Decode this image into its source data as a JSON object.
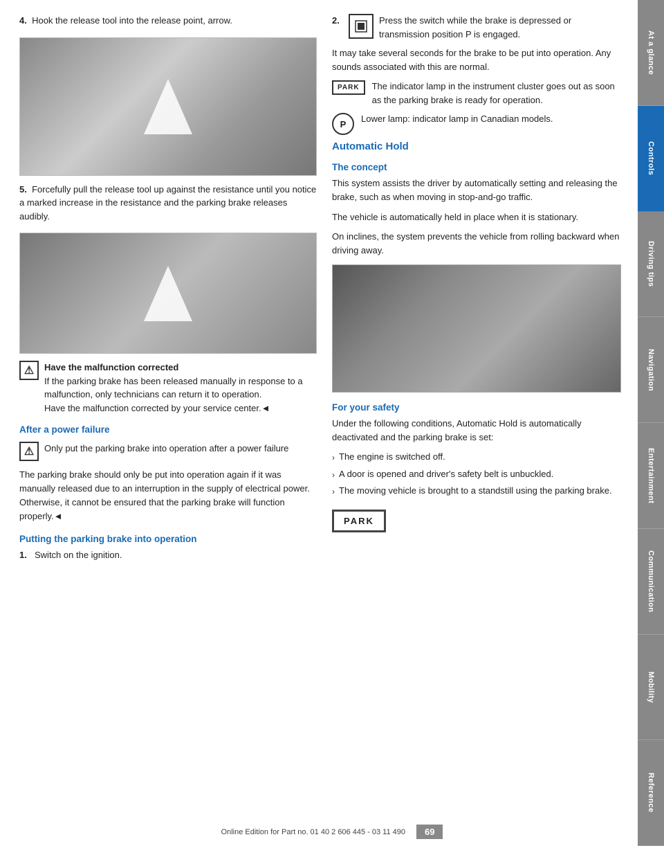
{
  "sidebar": {
    "tabs": [
      {
        "label": "At a glance",
        "active": false
      },
      {
        "label": "Controls",
        "active": true
      },
      {
        "label": "Driving tips",
        "active": false
      },
      {
        "label": "Navigation",
        "active": false
      },
      {
        "label": "Entertainment",
        "active": false
      },
      {
        "label": "Communication",
        "active": false
      },
      {
        "label": "Mobility",
        "active": false
      },
      {
        "label": "Reference",
        "active": false
      }
    ]
  },
  "left_col": {
    "step4": {
      "number": "4.",
      "text": "Hook the release tool into the release point, arrow."
    },
    "step5": {
      "number": "5.",
      "text": "Forcefully pull the release tool up against the resistance until you notice a marked increase in the resistance and the parking brake releases audibly."
    },
    "warning1": {
      "text": "Have the malfunction corrected\nIf the parking brake has been released manually in response to a malfunction, only technicians can return it to operation.\nHave the malfunction corrected by your service center.◄"
    },
    "section_power": "After a power failure",
    "warning2": {
      "text": "Only put the parking brake into operation after a power failure"
    },
    "power_text1": "The parking brake should only be put into operation again if it was manually released due to an interruption in the supply of electrical power. Otherwise, it cannot be ensured that the parking brake will function properly.◄",
    "section_putting": "Putting the parking brake into operation",
    "step1_put": {
      "number": "1.",
      "text": "Switch on the ignition."
    }
  },
  "right_col": {
    "step2": {
      "number": "2.",
      "text": "Press the switch while the brake is depressed or transmission position P is engaged."
    },
    "text_seconds": "It may take several seconds for the brake to be put into operation. Any sounds associated with this are normal.",
    "indicator1_label": "PARK",
    "indicator1_text": "The indicator lamp in the instrument cluster goes out as soon as the parking brake is ready for operation.",
    "indicator2_text": "Lower lamp: indicator lamp in Canadian models.",
    "section_auto": "Automatic Hold",
    "section_concept": "The concept",
    "concept_text1": "This system assists the driver by automatically setting and releasing the brake, such as when moving in stop-and-go traffic.",
    "concept_text2": "The vehicle is automatically held in place when it is stationary.",
    "concept_text3": "On inclines, the system prevents the vehicle from rolling backward when driving away.",
    "section_safety": "For your safety",
    "safety_intro": "Under the following conditions, Automatic Hold is automatically deactivated and the parking brake is set:",
    "safety_bullets": [
      "The engine is switched off.",
      "A door is opened and driver's safety belt is unbuckled.",
      "The moving vehicle is brought to a standstill using the parking brake."
    ],
    "park_badge_bottom": "PARK"
  },
  "footer": {
    "page_number": "69",
    "footer_text": "Online Edition for Part no. 01 40 2 606 445 - 03 11 490"
  }
}
